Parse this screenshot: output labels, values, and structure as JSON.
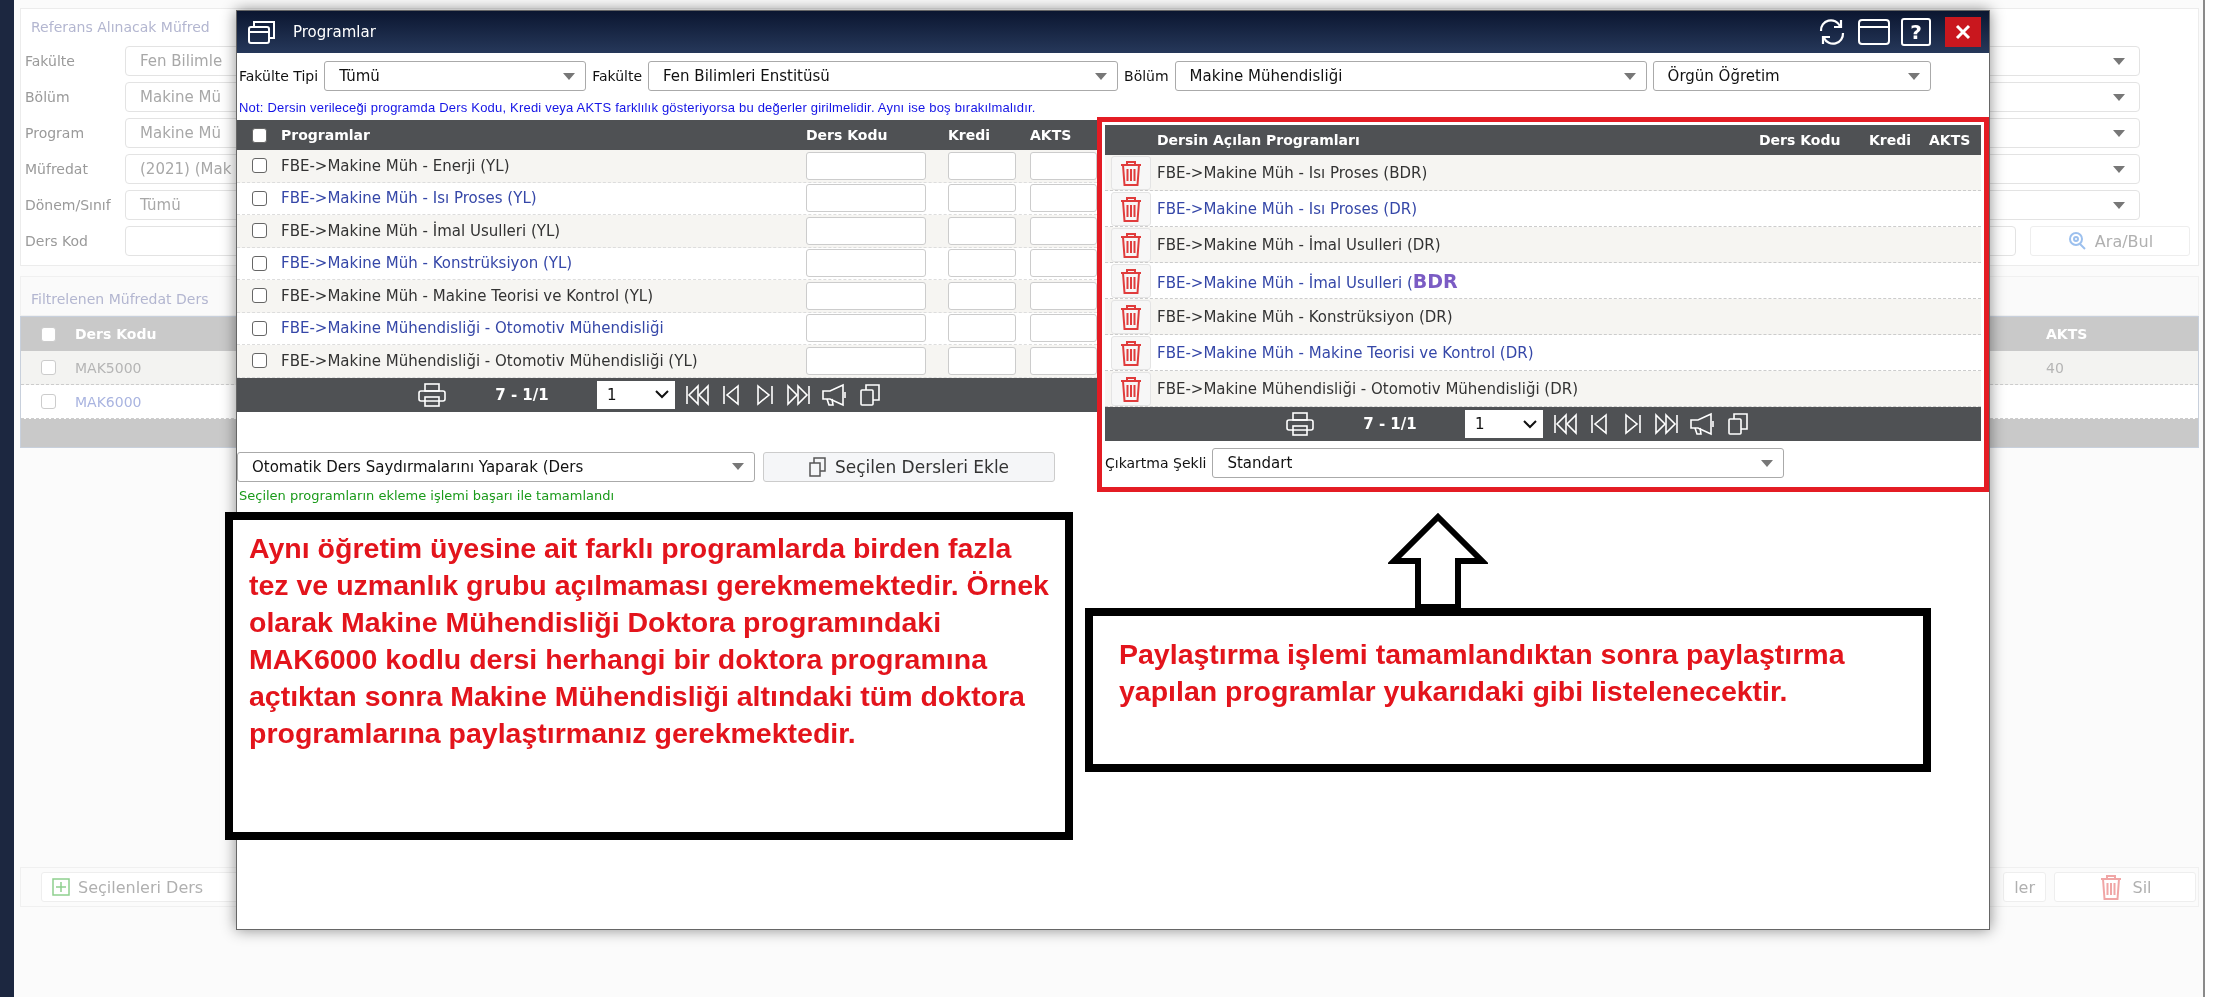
{
  "background": {
    "title": "Referans Alınacak Müfred",
    "fields": [
      {
        "label": "Fakülte",
        "value": "Fen Bilimle",
        "kind": "select"
      },
      {
        "label": "Bölüm",
        "value": "Makine Mü",
        "kind": "select"
      },
      {
        "label": "Program",
        "value": "Makine Mü",
        "kind": "select"
      },
      {
        "label": "Müfredat",
        "value": "(2021) (Mak",
        "kind": "select"
      },
      {
        "label": "Dönem/Sınıf",
        "value": "Tümü",
        "kind": "select"
      },
      {
        "label": "Ders Kod",
        "kind": "input"
      }
    ],
    "search_button": "Ara/Bul",
    "list_title": "Filtrelenen Müfredat Ders",
    "table": {
      "header_checked": false,
      "columns": [
        "Ders Kodu",
        "AKTS"
      ],
      "rows": [
        {
          "code": "MAK5000",
          "akts": "40",
          "checked": false
        },
        {
          "code": "MAK6000",
          "checked": false
        }
      ]
    },
    "add_button": "Seçilenleri Ders",
    "button_3": "ler",
    "delete_button": "Sil"
  },
  "dialog": {
    "title": "Programlar",
    "help_button": "?",
    "filters": [
      {
        "label": "Fakülte Tipi",
        "value": "Tümü"
      },
      {
        "label": "Fakülte",
        "value": "Fen Bilimleri Enstitüsü"
      },
      {
        "label": "Bölüm",
        "value": "Makine Mühendisliği"
      },
      {
        "value": "Örgün Öğretim"
      }
    ],
    "note": "Not: Dersin verileceği programda Ders Kodu, Kredi veya AKTS farklılık gösteriyorsa bu değerler girilmelidir. Aynı ise boş bırakılmalıdır.",
    "programs_table": {
      "header_checked": false,
      "columns": [
        "Programlar",
        "Ders Kodu",
        "Kredi",
        "AKTS"
      ],
      "rows": [
        {
          "name": "FBE->Makine Müh - Enerji (YL)",
          "checked": false
        },
        {
          "name": "FBE->Makine Müh - Isı Proses (YL)",
          "checked": false
        },
        {
          "name": "FBE->Makine Müh - İmal Usulleri (YL)",
          "checked": false
        },
        {
          "name": "FBE->Makine Müh - Konstrüksiyon (YL)",
          "checked": false
        },
        {
          "name": "FBE->Makine Müh - Makine Teorisi ve Kontrol (YL)",
          "checked": false
        },
        {
          "name": "FBE->Makine Mühendisliği - Otomotiv Mühendisliği",
          "checked": false
        },
        {
          "name": "FBE->Makine Mühendisliği - Otomotiv Mühendisliği (YL)",
          "checked": false
        }
      ],
      "pager": {
        "summary": "7 - 1/1",
        "page": "1"
      }
    },
    "mode_select": "Otomatik Ders Saydırmalarını Yaparak (Ders",
    "add_button": "Seçilen Dersleri Ekle",
    "status": "Seçilen programların ekleme işlemi başarı ile tamamlandı",
    "opened_table": {
      "columns": [
        "Dersin Açılan Programları",
        "Ders Kodu",
        "Kredi",
        "AKTS"
      ],
      "rows": [
        {
          "name": "FBE->Makine Müh - Isı Proses (BDR)"
        },
        {
          "name": "FBE->Makine Müh - Isı Proses (DR)"
        },
        {
          "name": "FBE->Makine Müh - İmal Usulleri (DR)"
        },
        {
          "name": "FBE->Makine Müh - İmal Usulleri (**BDR**"
        },
        {
          "name": "FBE->Makine Müh - Konstrüksiyon (DR)"
        },
        {
          "name": "FBE->Makine Müh - Makine Teorisi ve Kontrol (DR)"
        },
        {
          "name": "FBE->Makine Mühendisliği - Otomotiv Mühendisliği (DR)"
        }
      ],
      "pager": {
        "summary": "7 - 1/1",
        "page": "1"
      }
    },
    "removal": {
      "label": "Çıkartma Şekli",
      "value": "Standart"
    }
  },
  "annotations": [
    {
      "text": "Aynı öğretim üyesine ait farklı programlarda birden fazla tez ve uzmanlık grubu açılmaması gerekmemektedir. Örnek olarak Makine Mühendisliği Doktora programındaki MAK6000 kodlu dersi herhangi bir doktora programına açtıktan sonra Makine Mühendisliği altındaki tüm doktora programlarına paylaştırmanız gerekmektedir."
    },
    {
      "text": "Paylaştırma işlemi tamamlandıktan sonra paylaştırma yapılan programlar yukarıdaki gibi listelenecektir."
    }
  ]
}
